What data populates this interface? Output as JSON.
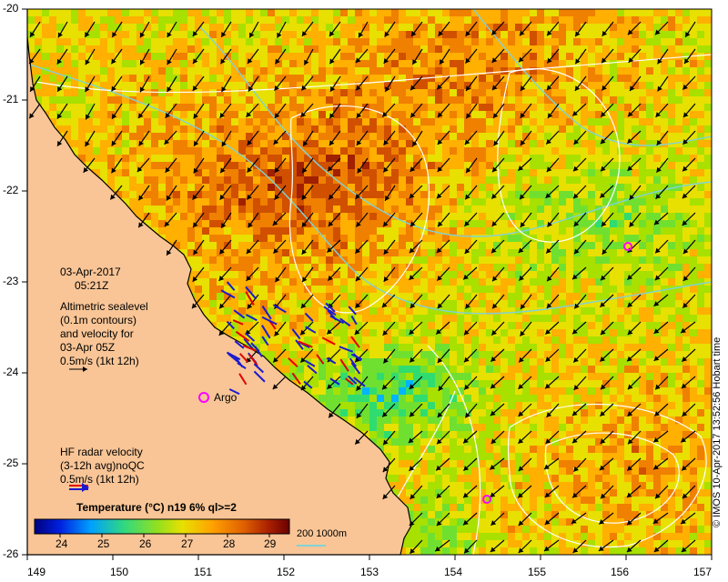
{
  "map": {
    "date": "03-Apr-2017",
    "time": "05:21Z",
    "altimetry_lines": [
      "Altimetric sealevel",
      "(0.1m contours)",
      "and velocity for",
      "03-Apr 05Z",
      "0.5m/s (1kt 12h)"
    ],
    "argo_label": "Argo",
    "hf_lines": [
      "HF radar velocity",
      "(3-12h avg)noQC",
      "0.5m/s (1kt 12h)"
    ],
    "credit": "© IMOS 10-Apr-2017 13:52:56 Hobart time",
    "colorbar_title": "Temperature (°C) n19 6% ql>=2",
    "colorbar_ticks": [
      "24",
      "25",
      "26",
      "27",
      "28",
      "29"
    ],
    "bathy_label": "200  1000m",
    "x_ticks": [
      "149",
      "150",
      "151",
      "152",
      "153",
      "154",
      "155",
      "156",
      "157"
    ],
    "y_ticks": [
      "-20",
      "-21",
      "-22",
      "-23",
      "-24",
      "-25",
      "-26"
    ],
    "colors": {
      "land": "#F9C596",
      "coast": "#000000",
      "contour": "#FFFFFF",
      "bathy": "#7FD3D6",
      "argo": "#FF00FF",
      "hf_red": "#E00000",
      "hf_blue": "#1A1AD0"
    },
    "colormap": [
      "#00007F",
      "#0000C0",
      "#0050FF",
      "#00B4FF",
      "#30DC70",
      "#70E030",
      "#A8E000",
      "#E8E000",
      "#FFB000",
      "#F08000",
      "#D05000",
      "#A02000",
      "#6A0000"
    ]
  }
}
